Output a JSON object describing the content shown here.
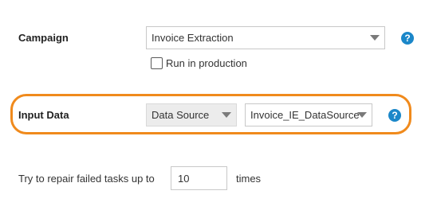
{
  "campaign": {
    "label": "Campaign",
    "selected": "Invoice Extraction",
    "help_icon": "question-circle-icon",
    "run_in_production": {
      "label": "Run in production",
      "checked": false
    }
  },
  "input_data": {
    "label": "Input Data",
    "source_type": "Data Source",
    "source_name": "Invoice_IE_DataSource",
    "help_icon": "question-circle-icon",
    "highlight_color": "#f08a1c"
  },
  "repair": {
    "prefix": "Try to repair failed tasks up to",
    "value": "10",
    "suffix": "times"
  },
  "colors": {
    "help": "#1b87c9",
    "highlight": "#f08a1c"
  }
}
